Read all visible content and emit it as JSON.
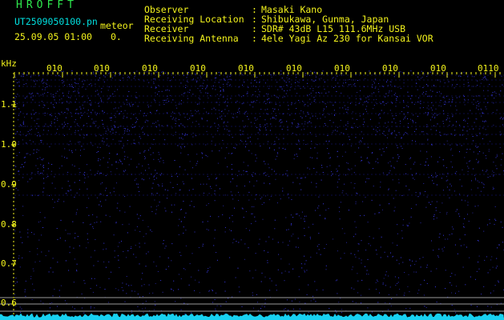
{
  "header": {
    "brand": "HROFFT",
    "filename": "UT2509050100.pn",
    "mode": "meteor",
    "datetime": "25.09.05 01:00",
    "count": "0.",
    "info": [
      {
        "label": "Observer",
        "value": "Masaki Kano"
      },
      {
        "label": "Receiving Location",
        "value": "Shibukawa, Gunma, Japan"
      },
      {
        "label": "Receiver",
        "value": "SDR# 43dB L15 111.6MHz USB"
      },
      {
        "label": "Receiving Antenna",
        "value": "4ele Yagi Az 230 for Kansai VOR"
      }
    ],
    "separator": ":"
  },
  "axis": {
    "unit": "kHz",
    "y_ticks": [
      "1.1",
      "1.0",
      "0.9",
      "0.8",
      "0.7",
      "0.6"
    ],
    "x_ticks": [
      "010",
      "010",
      "010",
      "010",
      "010",
      "010",
      "010",
      "010",
      "010",
      "0110"
    ]
  },
  "colors": {
    "background": "#000000",
    "text": "#f3f31c",
    "brand": "#2ee94e",
    "filename": "#00e0e0",
    "noise": "#2a2ad8",
    "baseline_trace": "#18d0f0",
    "guide_line": "#9a9a9a"
  }
}
